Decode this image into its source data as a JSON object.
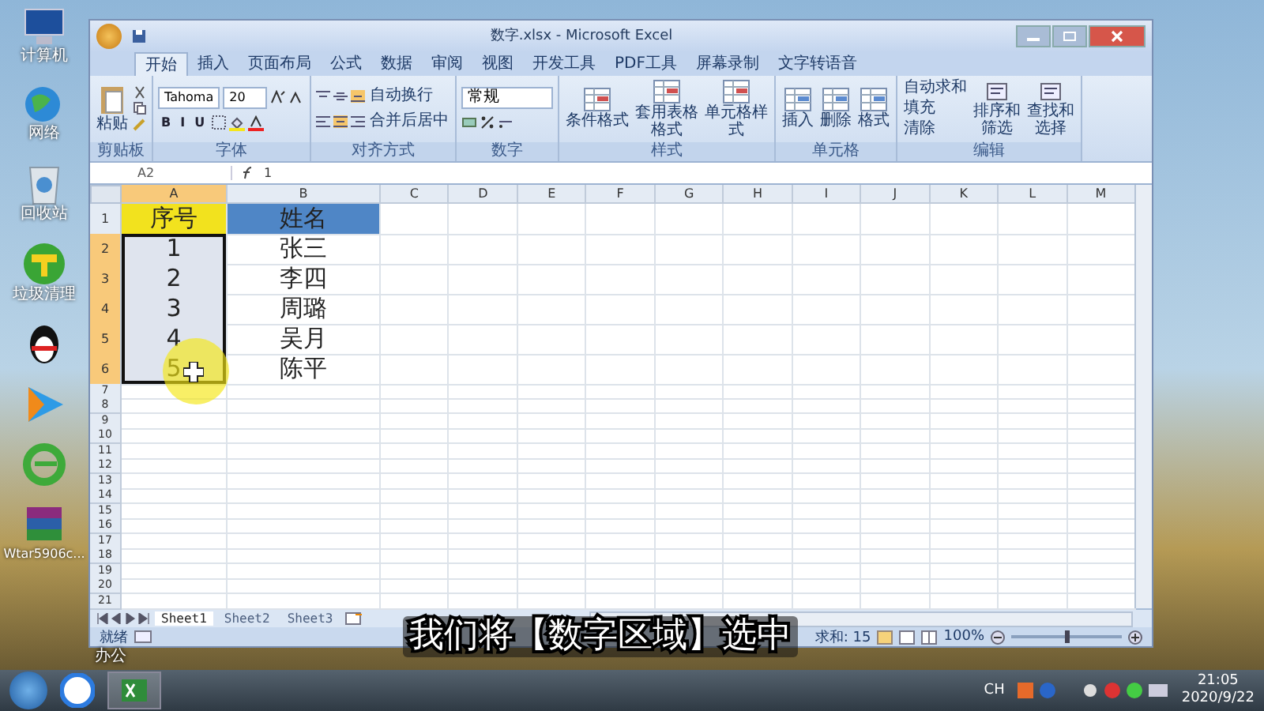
{
  "desktop_icons": [
    {
      "kind": "computer",
      "label": "计算机"
    },
    {
      "kind": "network",
      "label": "网络"
    },
    {
      "kind": "recycle",
      "label": "回收站"
    },
    {
      "kind": "cleaner",
      "label": "垃圾清理"
    },
    {
      "kind": "penguin"
    },
    {
      "kind": "video"
    },
    {
      "kind": "browser"
    },
    {
      "kind": "archive",
      "label": "Wtar5906c..."
    }
  ],
  "window": {
    "title": "数字.xlsx - Microsoft Excel"
  },
  "tabs": [
    {
      "label": "开始",
      "selected": true
    },
    {
      "label": "插入",
      "selected": false
    },
    {
      "label": "页面布局",
      "selected": false
    },
    {
      "label": "公式",
      "selected": false
    },
    {
      "label": "数据",
      "selected": false
    },
    {
      "label": "审阅",
      "selected": false
    },
    {
      "label": "视图",
      "selected": false
    },
    {
      "label": "开发工具",
      "selected": false
    },
    {
      "label": "PDF工具",
      "selected": false
    },
    {
      "label": "屏幕录制",
      "selected": false
    },
    {
      "label": "文字转语音",
      "selected": false
    }
  ],
  "ribbon_groups": [
    {
      "kind": "clipboard",
      "label": "剪贴板",
      "items": [
        {
          "kind": "large",
          "label": "粘贴"
        }
      ]
    },
    {
      "kind": "font",
      "label": "字体",
      "items": [
        {
          "kind": "combo",
          "value": "Tahoma"
        },
        {
          "kind": "combo",
          "value": "20"
        },
        {
          "kind": "letter",
          "label": "B"
        },
        {
          "kind": "letter",
          "label": "I"
        },
        {
          "kind": "letter",
          "label": "U"
        }
      ]
    },
    {
      "kind": "align",
      "label": "对齐方式",
      "items": [
        {
          "kind": "small",
          "label": "自动换行"
        },
        {
          "kind": "small",
          "label": "合并后居中"
        }
      ]
    },
    {
      "kind": "number",
      "label": "数字",
      "items": [
        {
          "kind": "combo",
          "value": "常规"
        }
      ]
    },
    {
      "kind": "styles",
      "label": "样式",
      "items": [
        {
          "kind": "large",
          "label": "条件格式"
        },
        {
          "kind": "large",
          "label": "套用表格格式"
        },
        {
          "kind": "large",
          "label": "单元格样式"
        }
      ]
    },
    {
      "kind": "cells",
      "label": "单元格",
      "items": [
        {
          "kind": "large",
          "label": "插入"
        },
        {
          "kind": "large",
          "label": "删除"
        },
        {
          "kind": "large",
          "label": "格式"
        }
      ]
    },
    {
      "kind": "editing",
      "label": "编辑",
      "items": [
        {
          "kind": "small",
          "label": "自动求和"
        },
        {
          "kind": "small",
          "label": "填充"
        },
        {
          "kind": "small",
          "label": "清除"
        },
        {
          "kind": "large",
          "label": "排序和筛选"
        },
        {
          "kind": "large",
          "label": "查找和选择"
        }
      ]
    }
  ],
  "name_box": "A2",
  "formula": "1",
  "columns": [
    {
      "label": "A",
      "selected": true
    },
    {
      "label": "B",
      "selected": false
    },
    {
      "label": "C",
      "selected": false
    },
    {
      "label": "D",
      "selected": false
    },
    {
      "label": "E",
      "selected": false
    },
    {
      "label": "F",
      "selected": false
    },
    {
      "label": "G",
      "selected": false
    },
    {
      "label": "H",
      "selected": false
    },
    {
      "label": "I",
      "selected": false
    },
    {
      "label": "J",
      "selected": false
    },
    {
      "label": "K",
      "selected": false
    },
    {
      "label": "L",
      "selected": false
    },
    {
      "label": "M",
      "selected": false
    }
  ],
  "rows": [
    {
      "header": "1",
      "selected": false,
      "cells": [
        {
          "value": "序号",
          "color": "#f2e21e"
        },
        {
          "value": "姓名",
          "color": "#4f86c6"
        }
      ]
    },
    {
      "header": "2",
      "selected": true,
      "cells": [
        {
          "value": "1"
        },
        {
          "value": "张三"
        }
      ]
    },
    {
      "header": "3",
      "selected": true,
      "cells": [
        {
          "value": "2"
        },
        {
          "value": "李四"
        }
      ]
    },
    {
      "header": "4",
      "selected": true,
      "cells": [
        {
          "value": "3"
        },
        {
          "value": "周璐"
        }
      ]
    },
    {
      "header": "5",
      "selected": true,
      "cells": [
        {
          "value": "4"
        },
        {
          "value": "吴月"
        }
      ]
    },
    {
      "header": "6",
      "selected": true,
      "cells": [
        {
          "value": "5"
        },
        {
          "value": "陈平"
        }
      ]
    },
    {
      "header": "7",
      "selected": false
    },
    {
      "header": "8",
      "selected": false
    },
    {
      "header": "9",
      "selected": false
    },
    {
      "header": "10",
      "selected": false
    },
    {
      "header": "11",
      "selected": false
    },
    {
      "header": "12",
      "selected": false
    },
    {
      "header": "13",
      "selected": false
    },
    {
      "header": "14",
      "selected": false
    },
    {
      "header": "15",
      "selected": false
    },
    {
      "header": "16",
      "selected": false
    },
    {
      "header": "17",
      "selected": false
    },
    {
      "header": "18",
      "selected": false
    },
    {
      "header": "19",
      "selected": false
    },
    {
      "header": "20",
      "selected": false
    },
    {
      "header": "21",
      "selected": false
    }
  ],
  "sheets": [
    {
      "label": "Sheet1",
      "selected": true
    },
    {
      "label": "Sheet2",
      "selected": false
    },
    {
      "label": "Sheet3",
      "selected": false
    }
  ],
  "status_bar": {
    "status": "就绪",
    "sum": "求和: 15",
    "zoom": "100%",
    "zoom_level": {
      "level": 0.5
    }
  },
  "subtitle": "我们将【数字区域】选中",
  "desktop_label": "办公",
  "tray": {
    "language": "CH",
    "time": "21:05",
    "date": "2020/9/22"
  }
}
